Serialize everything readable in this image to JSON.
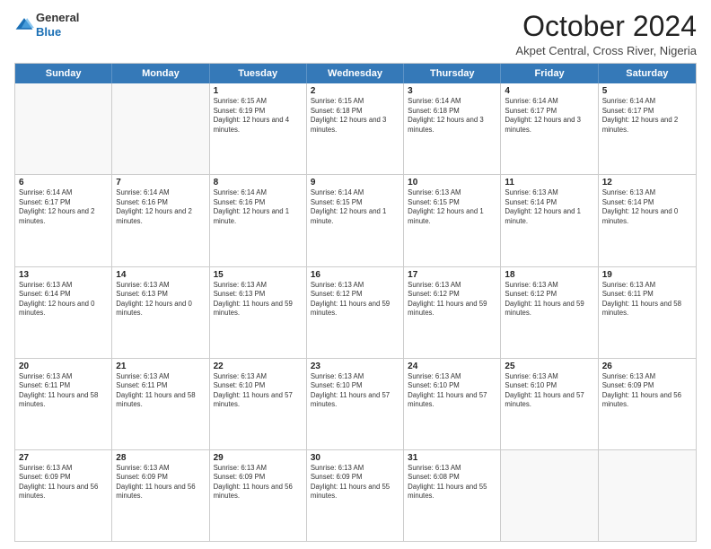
{
  "logo": {
    "general": "General",
    "blue": "Blue"
  },
  "header": {
    "month_year": "October 2024",
    "subtitle": "Akpet Central, Cross River, Nigeria"
  },
  "weekdays": [
    "Sunday",
    "Monday",
    "Tuesday",
    "Wednesday",
    "Thursday",
    "Friday",
    "Saturday"
  ],
  "weeks": [
    [
      {
        "day": "",
        "info": ""
      },
      {
        "day": "",
        "info": ""
      },
      {
        "day": "1",
        "info": "Sunrise: 6:15 AM\nSunset: 6:19 PM\nDaylight: 12 hours and 4 minutes."
      },
      {
        "day": "2",
        "info": "Sunrise: 6:15 AM\nSunset: 6:18 PM\nDaylight: 12 hours and 3 minutes."
      },
      {
        "day": "3",
        "info": "Sunrise: 6:14 AM\nSunset: 6:18 PM\nDaylight: 12 hours and 3 minutes."
      },
      {
        "day": "4",
        "info": "Sunrise: 6:14 AM\nSunset: 6:17 PM\nDaylight: 12 hours and 3 minutes."
      },
      {
        "day": "5",
        "info": "Sunrise: 6:14 AM\nSunset: 6:17 PM\nDaylight: 12 hours and 2 minutes."
      }
    ],
    [
      {
        "day": "6",
        "info": "Sunrise: 6:14 AM\nSunset: 6:17 PM\nDaylight: 12 hours and 2 minutes."
      },
      {
        "day": "7",
        "info": "Sunrise: 6:14 AM\nSunset: 6:16 PM\nDaylight: 12 hours and 2 minutes."
      },
      {
        "day": "8",
        "info": "Sunrise: 6:14 AM\nSunset: 6:16 PM\nDaylight: 12 hours and 1 minute."
      },
      {
        "day": "9",
        "info": "Sunrise: 6:14 AM\nSunset: 6:15 PM\nDaylight: 12 hours and 1 minute."
      },
      {
        "day": "10",
        "info": "Sunrise: 6:13 AM\nSunset: 6:15 PM\nDaylight: 12 hours and 1 minute."
      },
      {
        "day": "11",
        "info": "Sunrise: 6:13 AM\nSunset: 6:14 PM\nDaylight: 12 hours and 1 minute."
      },
      {
        "day": "12",
        "info": "Sunrise: 6:13 AM\nSunset: 6:14 PM\nDaylight: 12 hours and 0 minutes."
      }
    ],
    [
      {
        "day": "13",
        "info": "Sunrise: 6:13 AM\nSunset: 6:14 PM\nDaylight: 12 hours and 0 minutes."
      },
      {
        "day": "14",
        "info": "Sunrise: 6:13 AM\nSunset: 6:13 PM\nDaylight: 12 hours and 0 minutes."
      },
      {
        "day": "15",
        "info": "Sunrise: 6:13 AM\nSunset: 6:13 PM\nDaylight: 11 hours and 59 minutes."
      },
      {
        "day": "16",
        "info": "Sunrise: 6:13 AM\nSunset: 6:12 PM\nDaylight: 11 hours and 59 minutes."
      },
      {
        "day": "17",
        "info": "Sunrise: 6:13 AM\nSunset: 6:12 PM\nDaylight: 11 hours and 59 minutes."
      },
      {
        "day": "18",
        "info": "Sunrise: 6:13 AM\nSunset: 6:12 PM\nDaylight: 11 hours and 59 minutes."
      },
      {
        "day": "19",
        "info": "Sunrise: 6:13 AM\nSunset: 6:11 PM\nDaylight: 11 hours and 58 minutes."
      }
    ],
    [
      {
        "day": "20",
        "info": "Sunrise: 6:13 AM\nSunset: 6:11 PM\nDaylight: 11 hours and 58 minutes."
      },
      {
        "day": "21",
        "info": "Sunrise: 6:13 AM\nSunset: 6:11 PM\nDaylight: 11 hours and 58 minutes."
      },
      {
        "day": "22",
        "info": "Sunrise: 6:13 AM\nSunset: 6:10 PM\nDaylight: 11 hours and 57 minutes."
      },
      {
        "day": "23",
        "info": "Sunrise: 6:13 AM\nSunset: 6:10 PM\nDaylight: 11 hours and 57 minutes."
      },
      {
        "day": "24",
        "info": "Sunrise: 6:13 AM\nSunset: 6:10 PM\nDaylight: 11 hours and 57 minutes."
      },
      {
        "day": "25",
        "info": "Sunrise: 6:13 AM\nSunset: 6:10 PM\nDaylight: 11 hours and 57 minutes."
      },
      {
        "day": "26",
        "info": "Sunrise: 6:13 AM\nSunset: 6:09 PM\nDaylight: 11 hours and 56 minutes."
      }
    ],
    [
      {
        "day": "27",
        "info": "Sunrise: 6:13 AM\nSunset: 6:09 PM\nDaylight: 11 hours and 56 minutes."
      },
      {
        "day": "28",
        "info": "Sunrise: 6:13 AM\nSunset: 6:09 PM\nDaylight: 11 hours and 56 minutes."
      },
      {
        "day": "29",
        "info": "Sunrise: 6:13 AM\nSunset: 6:09 PM\nDaylight: 11 hours and 56 minutes."
      },
      {
        "day": "30",
        "info": "Sunrise: 6:13 AM\nSunset: 6:09 PM\nDaylight: 11 hours and 55 minutes."
      },
      {
        "day": "31",
        "info": "Sunrise: 6:13 AM\nSunset: 6:08 PM\nDaylight: 11 hours and 55 minutes."
      },
      {
        "day": "",
        "info": ""
      },
      {
        "day": "",
        "info": ""
      }
    ]
  ]
}
